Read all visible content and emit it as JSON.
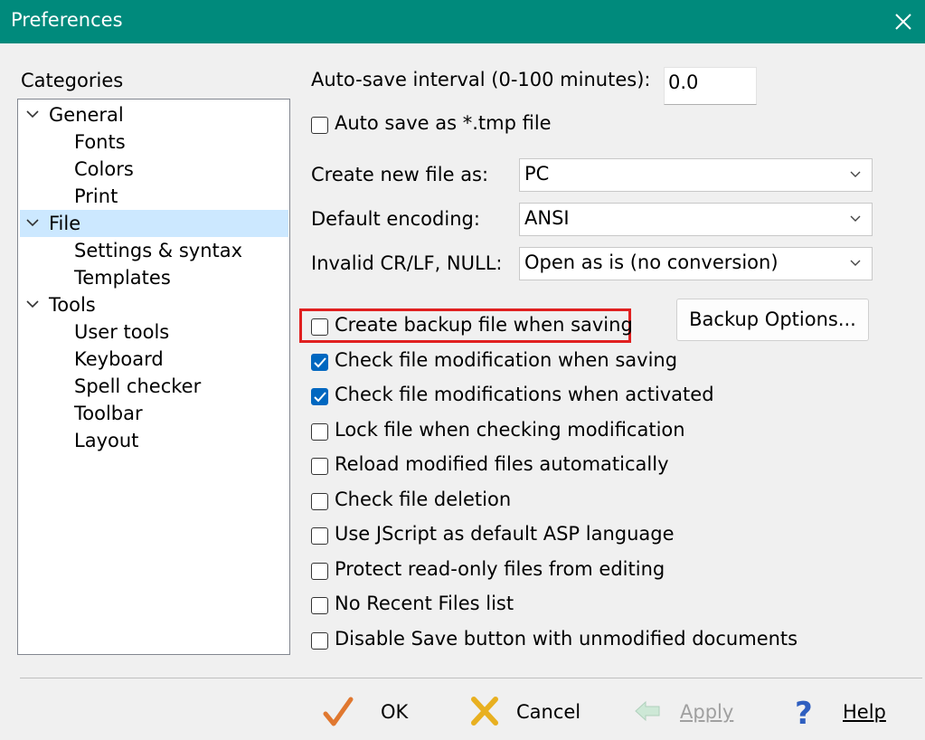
{
  "window": {
    "title": "Preferences"
  },
  "categories": {
    "label": "Categories",
    "tree": [
      {
        "label": "General",
        "children": [
          "Fonts",
          "Colors",
          "Print"
        ]
      },
      {
        "label": "File",
        "selected": true,
        "children": [
          "Settings & syntax",
          "Templates"
        ]
      },
      {
        "label": "Tools",
        "children": [
          "User tools",
          "Keyboard",
          "Spell checker",
          "Toolbar",
          "Layout"
        ]
      }
    ]
  },
  "file": {
    "autosave_label": "Auto-save interval (0-100 minutes):",
    "autosave_value": "0.0",
    "autosave_tmp": {
      "label": "Auto save as *.tmp file",
      "checked": false
    },
    "create_new_label": "Create new file as:",
    "create_new_value": "PC",
    "encoding_label": "Default encoding:",
    "encoding_value": "ANSI",
    "invalid_label": "Invalid CR/LF, NULL:",
    "invalid_value": "Open as is (no conversion)",
    "backup_options_label": "Backup Options...",
    "checkboxes": [
      {
        "label": "Create backup file when saving",
        "checked": false
      },
      {
        "label": "Check file modification when saving",
        "checked": true
      },
      {
        "label": "Check file modifications when activated",
        "checked": true
      },
      {
        "label": "Lock file when checking modification",
        "checked": false
      },
      {
        "label": "Reload modified files automatically",
        "checked": false
      },
      {
        "label": "Check file deletion",
        "checked": false
      },
      {
        "label": "Use JScript as default ASP language",
        "checked": false
      },
      {
        "label": "Protect read-only files from editing",
        "checked": false
      },
      {
        "label": "No Recent Files list",
        "checked": false
      },
      {
        "label": "Disable Save button with unmodified documents",
        "checked": false
      }
    ]
  },
  "footer": {
    "ok": "OK",
    "cancel": "Cancel",
    "apply": "Apply",
    "help": "Help"
  },
  "icons": {
    "close": "close-icon",
    "expand": "chevron-down-icon",
    "dropdown": "dropdown-arrow-icon",
    "ok": "checkmark-icon",
    "cancel": "cross-icon",
    "apply": "back-arrow-icon",
    "help": "question-mark-icon"
  },
  "colors": {
    "titlebar": "#008a7c",
    "selection": "#cce8ff",
    "checkbox_on": "#0067c0",
    "highlight": "#e02020"
  }
}
